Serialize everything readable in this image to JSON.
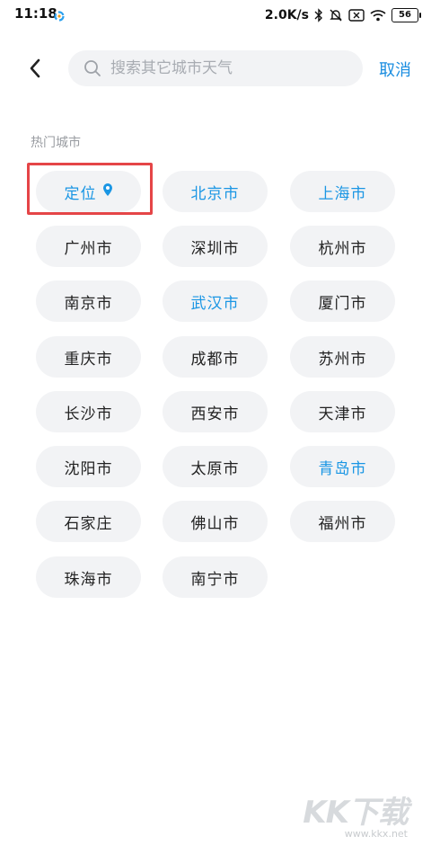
{
  "status": {
    "time": "11:18",
    "net_speed": "2.0K/s",
    "battery": "56"
  },
  "header": {
    "search_placeholder": "搜索其它城市天气",
    "cancel_label": "取消"
  },
  "section": {
    "title": "热门城市"
  },
  "cities": [
    {
      "label": "定位",
      "highlighted": true
    },
    {
      "label": "北京市",
      "highlighted": true
    },
    {
      "label": "上海市",
      "highlighted": true
    },
    {
      "label": "广州市",
      "highlighted": false
    },
    {
      "label": "深圳市",
      "highlighted": false
    },
    {
      "label": "杭州市",
      "highlighted": false
    },
    {
      "label": "南京市",
      "highlighted": false
    },
    {
      "label": "武汉市",
      "highlighted": true
    },
    {
      "label": "厦门市",
      "highlighted": false
    },
    {
      "label": "重庆市",
      "highlighted": false
    },
    {
      "label": "成都市",
      "highlighted": false
    },
    {
      "label": "苏州市",
      "highlighted": false
    },
    {
      "label": "长沙市",
      "highlighted": false
    },
    {
      "label": "西安市",
      "highlighted": false
    },
    {
      "label": "天津市",
      "highlighted": false
    },
    {
      "label": "沈阳市",
      "highlighted": false
    },
    {
      "label": "太原市",
      "highlighted": false
    },
    {
      "label": "青岛市",
      "highlighted": true
    },
    {
      "label": "石家庄",
      "highlighted": false
    },
    {
      "label": "佛山市",
      "highlighted": false
    },
    {
      "label": "福州市",
      "highlighted": false
    },
    {
      "label": "珠海市",
      "highlighted": false
    },
    {
      "label": "南宁市",
      "highlighted": false
    }
  ],
  "icons": {
    "locate": "location-pin-icon",
    "back": "chevron-left-icon",
    "search": "search-icon"
  },
  "colors": {
    "accent": "#1a8de0",
    "chip_bg": "#f2f3f5",
    "highlight_box": "#e54547"
  },
  "watermark": {
    "logo": "KK下载",
    "url": "www.kkx.net"
  }
}
